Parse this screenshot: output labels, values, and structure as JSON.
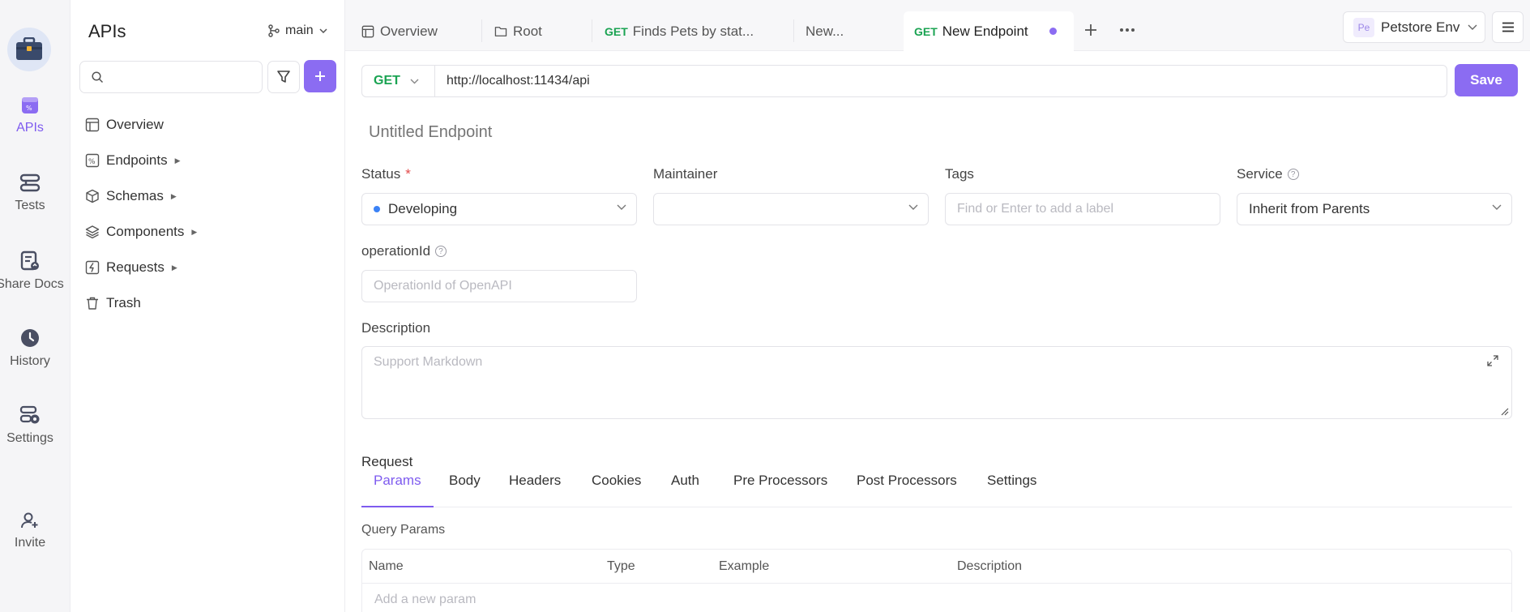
{
  "rail": {
    "items": [
      {
        "label": "APIs",
        "icon": "apis-icon"
      },
      {
        "label": "Tests",
        "icon": "tests-icon"
      },
      {
        "label": "Share Docs",
        "icon": "share-docs-icon"
      },
      {
        "label": "History",
        "icon": "history-icon"
      },
      {
        "label": "Settings",
        "icon": "settings-icon"
      },
      {
        "label": "Invite",
        "icon": "invite-icon"
      }
    ],
    "active": "APIs"
  },
  "sidebar": {
    "title": "APIs",
    "branch": "main",
    "search_placeholder": "",
    "tree": [
      {
        "label": "Overview",
        "icon": "overview-icon",
        "expandable": false
      },
      {
        "label": "Endpoints",
        "icon": "endpoints-icon",
        "expandable": true
      },
      {
        "label": "Schemas",
        "icon": "schemas-icon",
        "expandable": true
      },
      {
        "label": "Components",
        "icon": "components-icon",
        "expandable": true
      },
      {
        "label": "Requests",
        "icon": "requests-icon",
        "expandable": true
      },
      {
        "label": "Trash",
        "icon": "trash-icon",
        "expandable": false
      }
    ]
  },
  "tabs": [
    {
      "label": "Overview",
      "icon": "overview-icon",
      "method": ""
    },
    {
      "label": "Root",
      "icon": "folder-icon",
      "method": ""
    },
    {
      "label": "Finds Pets by stat...",
      "icon": "",
      "method": "GET"
    },
    {
      "label": "New...",
      "icon": "",
      "method": ""
    },
    {
      "label": "New Endpoint",
      "icon": "",
      "method": "GET",
      "active": true,
      "unsaved": true
    }
  ],
  "environment": {
    "badge": "Pe",
    "name": "Petstore Env"
  },
  "request": {
    "method": "GET",
    "url": "http://localhost:11434/api",
    "save_label": "Save",
    "name_placeholder": "Untitled Endpoint"
  },
  "fields": {
    "status_label": "Status",
    "status_required": "*",
    "status_value": "Developing",
    "maintainer_label": "Maintainer",
    "maintainer_value": "",
    "tags_label": "Tags",
    "tags_placeholder": "Find or Enter to add a label",
    "service_label": "Service",
    "service_value": "Inherit from Parents",
    "operation_id_label": "operationId",
    "operation_id_placeholder": "OperationId of OpenAPI",
    "description_label": "Description",
    "description_placeholder": "Support Markdown"
  },
  "request_section": {
    "title": "Request",
    "tabs": [
      "Params",
      "Body",
      "Headers",
      "Cookies",
      "Auth",
      "Pre Processors",
      "Post Processors",
      "Settings"
    ],
    "active_tab": "Params",
    "query_params_title": "Query Params",
    "columns": [
      "Name",
      "Type",
      "Example",
      "Description"
    ],
    "add_param_placeholder": "Add a new param"
  },
  "colors": {
    "accent": "#8b6cf2",
    "get_method": "#1aa352",
    "status_developing": "#3b82f6",
    "required": "#e24b4b"
  }
}
